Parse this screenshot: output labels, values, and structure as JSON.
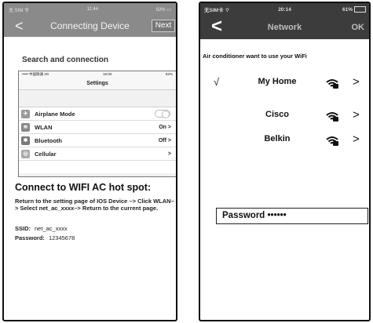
{
  "left_screen": {
    "status": {
      "carrier": "无 SIM 令",
      "time": "11:44",
      "battery": "92%"
    },
    "nav": {
      "back": "<",
      "title": "Connecting Device",
      "next": "Next"
    },
    "section_title": "Search and connection",
    "inner_screenshot": {
      "status": {
        "carrier": "••••• 中国联通 3G",
        "time": "16:00",
        "battery": "82%"
      },
      "title": "Settings",
      "rows": [
        {
          "label": "Airplane Mode",
          "value": "",
          "icon": "airplane-icon",
          "icon_char": "✈",
          "icon_color": "#999999"
        },
        {
          "label": "WLAN",
          "value": "On >",
          "icon": "wifi-icon",
          "icon_char": "≋",
          "icon_color": "#888888"
        },
        {
          "label": "Bluetooth",
          "value": "Off >",
          "icon": "bluetooth-icon",
          "icon_char": "✱",
          "icon_color": "#777777"
        },
        {
          "label": "Cellular",
          "value": ">",
          "icon": "cellular-icon",
          "icon_char": "◎",
          "icon_color": "#aaaaaa"
        }
      ]
    },
    "heading": "Connect to WIFI AC hot spot:",
    "description": "Return to the setting page of IOS Device –> Click WLAN–> Select net_ac_xxxx–> Return to the current page.",
    "ssid_label": "SSID:",
    "ssid_value": "net_ac_xxxx",
    "password_label": "Password:",
    "password_value": "12345678"
  },
  "right_screen": {
    "status": {
      "carrier": "无SIM卡",
      "time": "20:14",
      "battery": "61%"
    },
    "nav": {
      "back": "<",
      "title": "Network",
      "ok": "OK"
    },
    "prompt": "Air conditioner want to use your WiFi",
    "networks": [
      {
        "name": "My Home",
        "checked": true,
        "check": "√",
        "chevron": ">"
      },
      {
        "name": "Cisco",
        "checked": false,
        "check": "",
        "chevron": ">"
      },
      {
        "name": "Belkin",
        "checked": false,
        "check": "",
        "chevron": ">"
      }
    ],
    "password_field": "Password ••••••"
  }
}
